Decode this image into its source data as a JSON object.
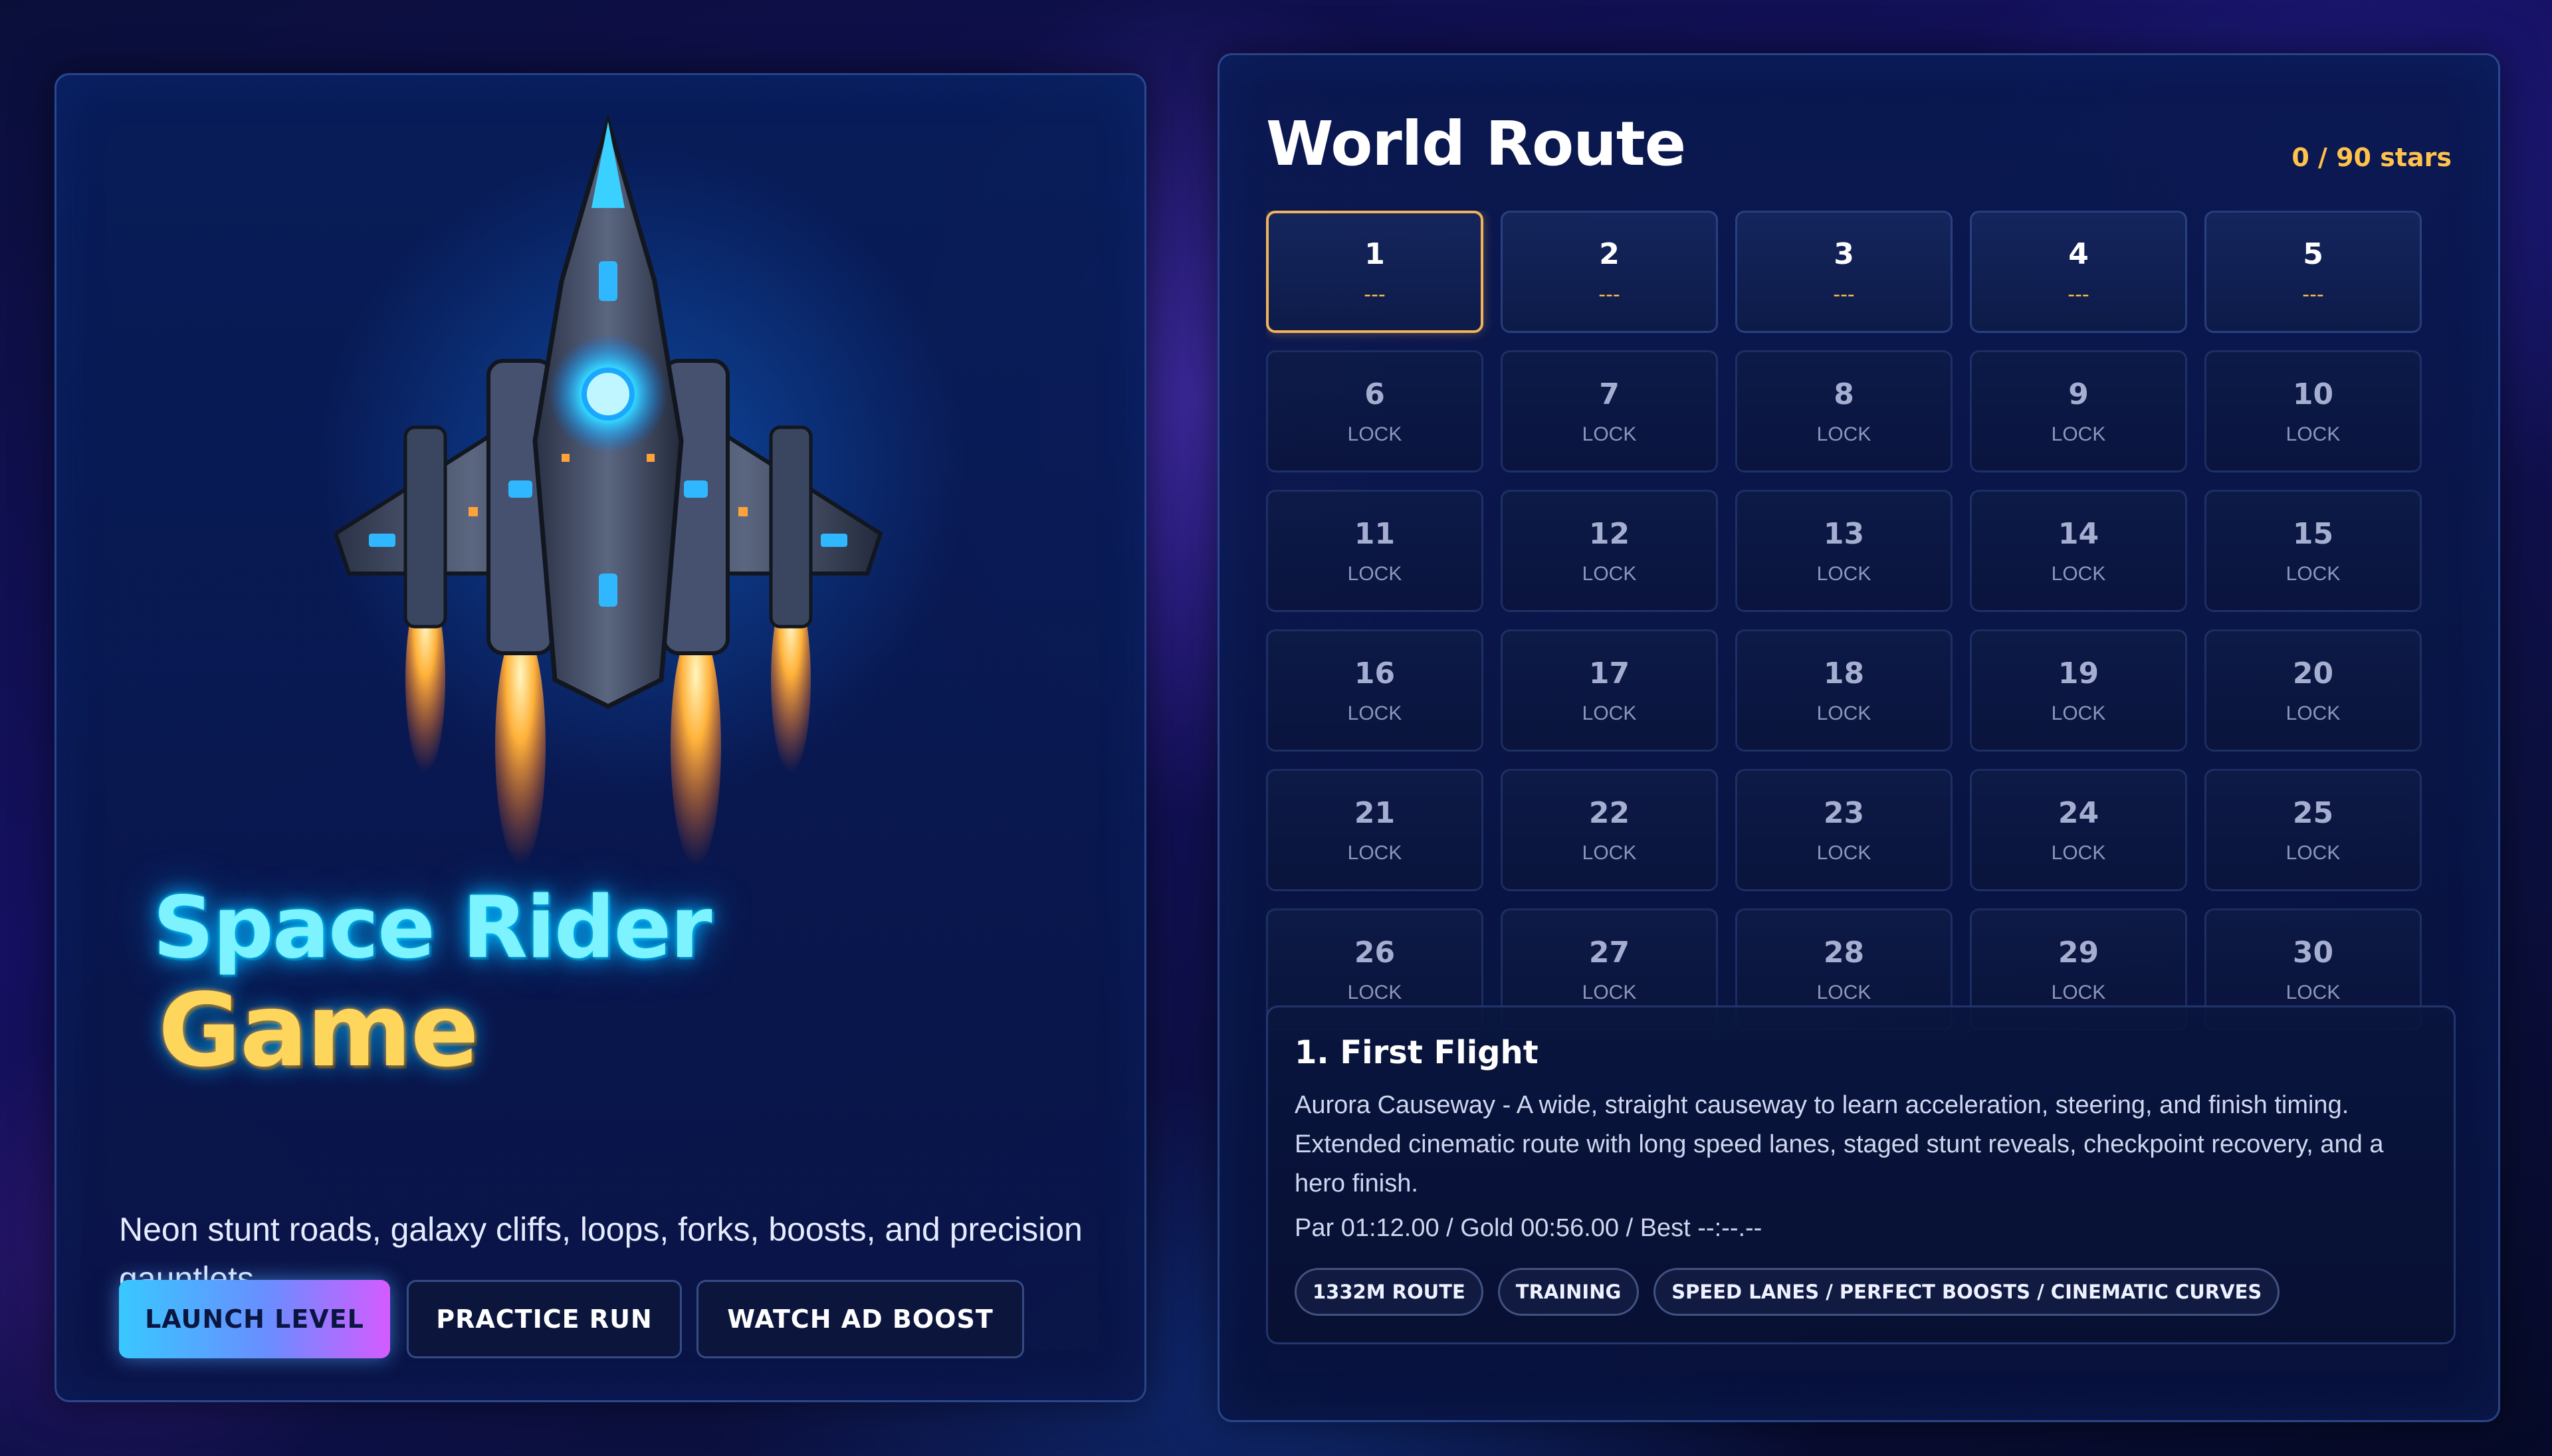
{
  "hero": {
    "title_line1": "Space Rider",
    "title_line2": "Game",
    "tagline": "Neon stunt roads, galaxy cliffs, loops, forks, boosts, and precision gauntlets.",
    "buttons": {
      "launch": "LAUNCH LEVEL",
      "practice": "PRACTICE RUN",
      "watch": "WATCH AD BOOST"
    }
  },
  "route": {
    "title": "World Route",
    "stars": "0 / 90 stars",
    "levels": [
      {
        "num": "1",
        "status": "---"
      },
      {
        "num": "2",
        "status": "---"
      },
      {
        "num": "3",
        "status": "---"
      },
      {
        "num": "4",
        "status": "---"
      },
      {
        "num": "5",
        "status": "---"
      },
      {
        "num": "6",
        "status": "LOCK"
      },
      {
        "num": "7",
        "status": "LOCK"
      },
      {
        "num": "8",
        "status": "LOCK"
      },
      {
        "num": "9",
        "status": "LOCK"
      },
      {
        "num": "10",
        "status": "LOCK"
      },
      {
        "num": "11",
        "status": "LOCK"
      },
      {
        "num": "12",
        "status": "LOCK"
      },
      {
        "num": "13",
        "status": "LOCK"
      },
      {
        "num": "14",
        "status": "LOCK"
      },
      {
        "num": "15",
        "status": "LOCK"
      },
      {
        "num": "16",
        "status": "LOCK"
      },
      {
        "num": "17",
        "status": "LOCK"
      },
      {
        "num": "18",
        "status": "LOCK"
      },
      {
        "num": "19",
        "status": "LOCK"
      },
      {
        "num": "20",
        "status": "LOCK"
      },
      {
        "num": "21",
        "status": "LOCK"
      },
      {
        "num": "22",
        "status": "LOCK"
      },
      {
        "num": "23",
        "status": "LOCK"
      },
      {
        "num": "24",
        "status": "LOCK"
      },
      {
        "num": "25",
        "status": "LOCK"
      },
      {
        "num": "26",
        "status": "LOCK"
      },
      {
        "num": "27",
        "status": "LOCK"
      },
      {
        "num": "28",
        "status": "LOCK"
      },
      {
        "num": "29",
        "status": "LOCK"
      },
      {
        "num": "30",
        "status": "LOCK"
      }
    ]
  },
  "details": {
    "title": "1. First Flight",
    "description": "Aurora Causeway - A wide, straight causeway to learn acceleration, steering, and finish timing. Extended cinematic route with long speed lanes, staged stunt reveals, checkpoint recovery, and a hero finish.",
    "times": "Par 01:12.00 / Gold 00:56.00 / Best --:--.--",
    "chips": [
      "1332M ROUTE",
      "TRAINING",
      "SPEED LANES / PERFECT BOOSTS / CINEMATIC CURVES"
    ]
  },
  "colors": {
    "accent_gold": "#ffc24a",
    "title_cyan": "#7df3ff",
    "title_yellow": "#ffd65c",
    "launch_gradient": [
      "#38c8ff",
      "#6a8dff",
      "#d45bff"
    ]
  }
}
